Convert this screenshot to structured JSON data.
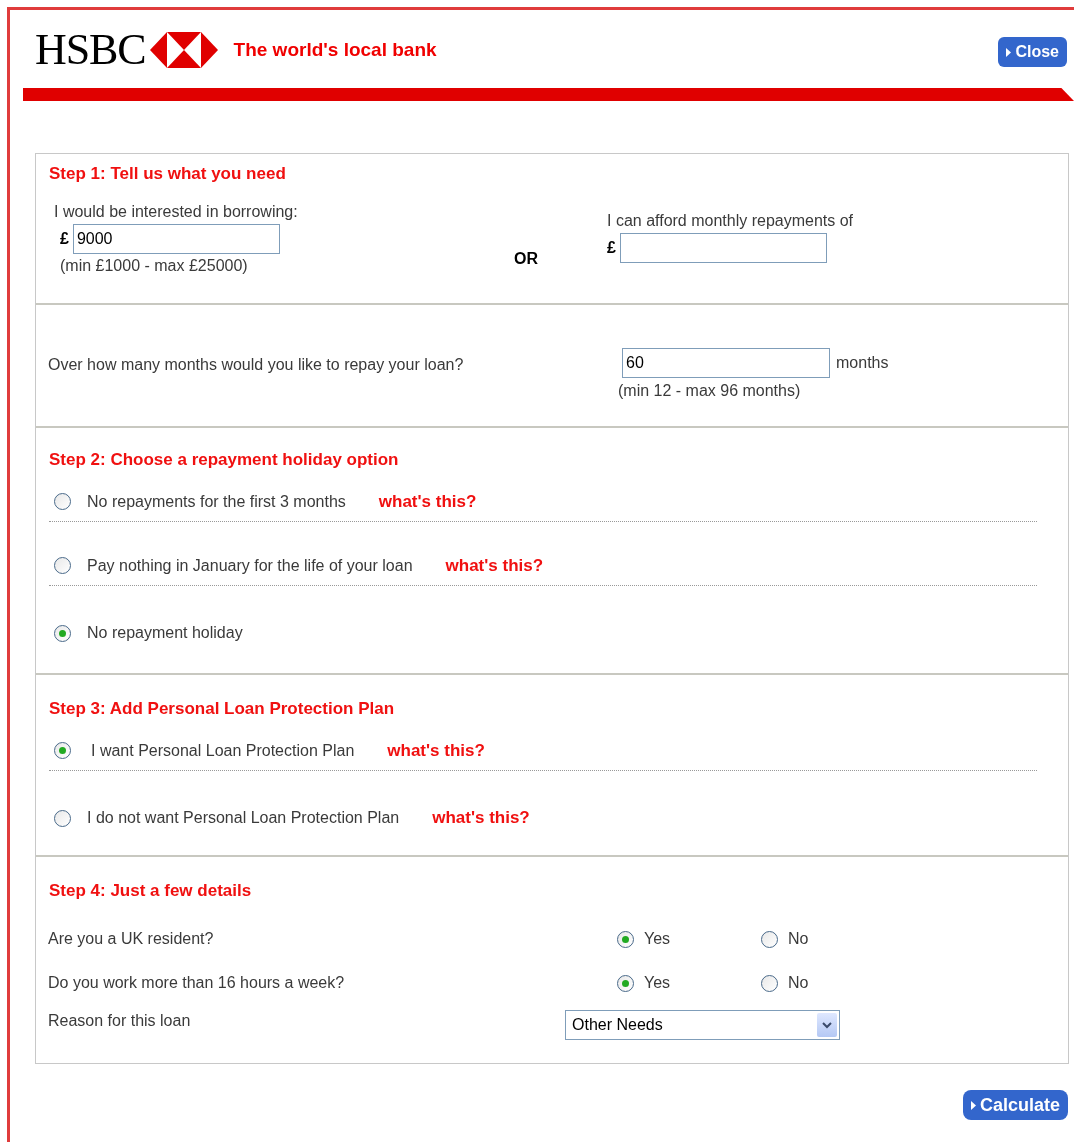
{
  "header": {
    "logo_text": "HSBC",
    "tagline": "The world's local bank",
    "close_button": "Close"
  },
  "step1": {
    "heading": "Step 1: Tell us what you need",
    "borrow": {
      "label": "I would be interested in borrowing:",
      "currency": "£",
      "value": "9000",
      "hint": "(min £1000 - max £25000)"
    },
    "separator": "OR",
    "afford": {
      "label": "I can afford monthly repayments of",
      "currency": "£"
    }
  },
  "term": {
    "question": "Over how many months would you like to repay your loan?",
    "value": "60",
    "unit": "months",
    "hint": "(min 12 - max 96 months)"
  },
  "step2": {
    "heading": "Step 2: Choose a repayment holiday option",
    "options": [
      {
        "label": "No repayments for the first 3 months",
        "help_link": "what's this?",
        "selected": false
      },
      {
        "label": "Pay nothing in January for the life of your loan",
        "help_link": "what's this?",
        "selected": false
      },
      {
        "label": "No repayment holiday",
        "selected": true
      }
    ]
  },
  "step3": {
    "heading": "Step 3: Add Personal Loan Protection Plan",
    "options": [
      {
        "label": "I want Personal Loan Protection Plan",
        "help_link": "what's this?",
        "selected": true
      },
      {
        "label": "I do not want Personal Loan Protection Plan",
        "help_link": "what's this?",
        "selected": false
      }
    ]
  },
  "step4": {
    "heading": "Step 4: Just a few details",
    "questions": [
      {
        "label": "Are you a UK resident?",
        "options": [
          {
            "label": "Yes",
            "selected": true
          },
          {
            "label": "No",
            "selected": false
          }
        ]
      },
      {
        "label": "Do you work more than 16 hours a week?",
        "options": [
          {
            "label": "Yes",
            "selected": true
          },
          {
            "label": "No",
            "selected": false
          }
        ]
      }
    ],
    "reason": {
      "label": "Reason for this loan",
      "value": "Other Needs"
    }
  },
  "calculate_button": "Calculate"
}
